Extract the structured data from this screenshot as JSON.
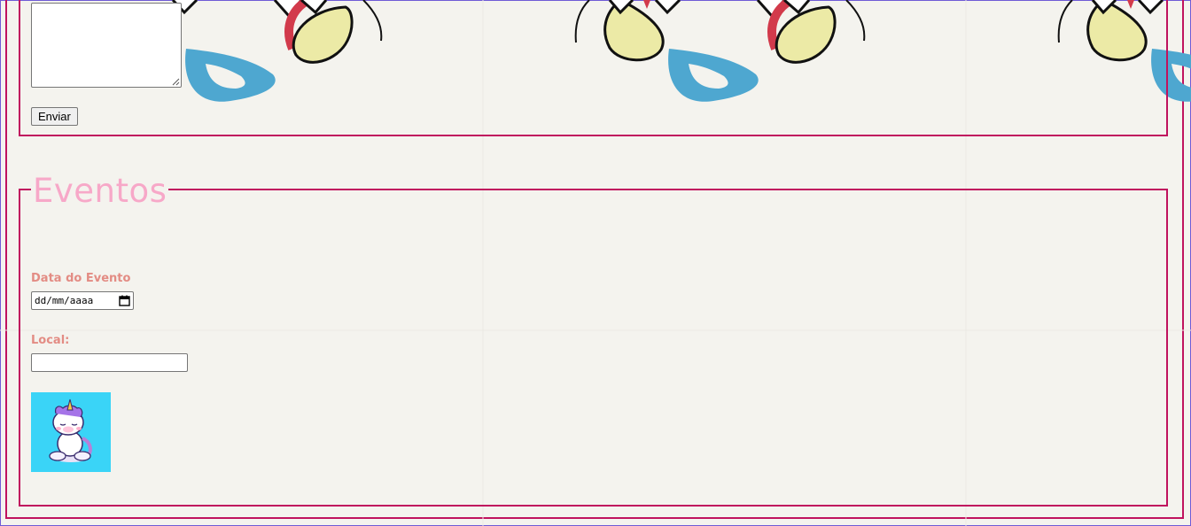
{
  "form_top": {
    "message_textarea": {
      "value": ""
    },
    "submit_label": "Enviar"
  },
  "events": {
    "legend": "Eventos",
    "date_label": "Data do Evento",
    "date_placeholder": "dd/mm/aaaa",
    "local_label": "Local:",
    "local_value": "",
    "image": {
      "alt": "unicorn meditating",
      "background": "#3ad4f7"
    }
  },
  "icons": {
    "calendar": "calendar-icon",
    "resize": "resize-grip-icon"
  },
  "colors": {
    "border_accent": "#c0125e",
    "legend_text": "#f7a8c8",
    "label_text": "#e38c84",
    "background": "#f4f3ee"
  }
}
